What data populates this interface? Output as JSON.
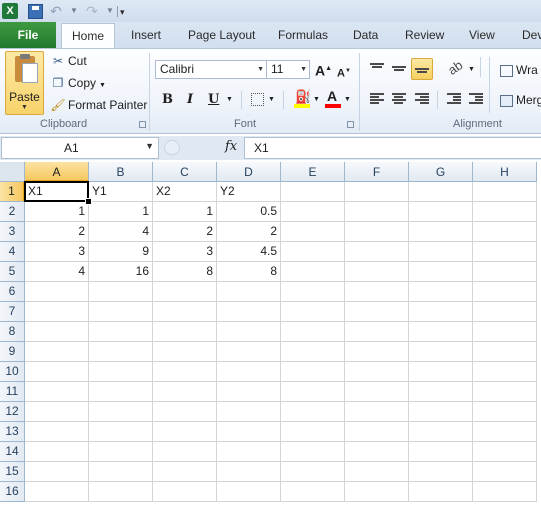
{
  "title_bar": {
    "app_icon": "X",
    "quick_access": [
      "save-icon",
      "undo-icon",
      "redo-icon",
      "customize-arrow"
    ]
  },
  "tabs": [
    "File",
    "Home",
    "Insert",
    "Page Layout",
    "Formulas",
    "Data",
    "Review",
    "View",
    "Dev"
  ],
  "ribbon": {
    "clipboard": {
      "paste_label": "Paste",
      "cut_label": "Cut",
      "copy_label": "Copy",
      "format_painter_label": "Format Painter",
      "group_label": "Clipboard"
    },
    "font": {
      "font_name": "Calibri",
      "font_size": "11",
      "bold": "B",
      "italic": "I",
      "underline": "U",
      "font_color_letter": "A",
      "fill_color": "#ffff00",
      "text_color": "#ff0000",
      "group_label": "Font"
    },
    "alignment": {
      "wrap_label": "Wra",
      "merge_label": "Merg",
      "group_label": "Alignment"
    }
  },
  "formula_bar": {
    "name_box": "A1",
    "fx_symbol": "fx",
    "formula": "X1"
  },
  "sheet": {
    "columns": [
      "A",
      "B",
      "C",
      "D",
      "E",
      "F",
      "G",
      "H"
    ],
    "selected_column": "A",
    "selected_row": "1",
    "row_numbers": [
      "1",
      "2",
      "3",
      "4",
      "5",
      "6",
      "7",
      "8",
      "9",
      "10",
      "11",
      "12",
      "13",
      "14",
      "15",
      "16"
    ],
    "rows": [
      [
        "X1",
        "Y1",
        "X2",
        "Y2"
      ],
      [
        "1",
        "1",
        "1",
        "0.5"
      ],
      [
        "2",
        "4",
        "2",
        "2"
      ],
      [
        "3",
        "9",
        "3",
        "4.5"
      ],
      [
        "4",
        "16",
        "8",
        "8"
      ]
    ]
  }
}
